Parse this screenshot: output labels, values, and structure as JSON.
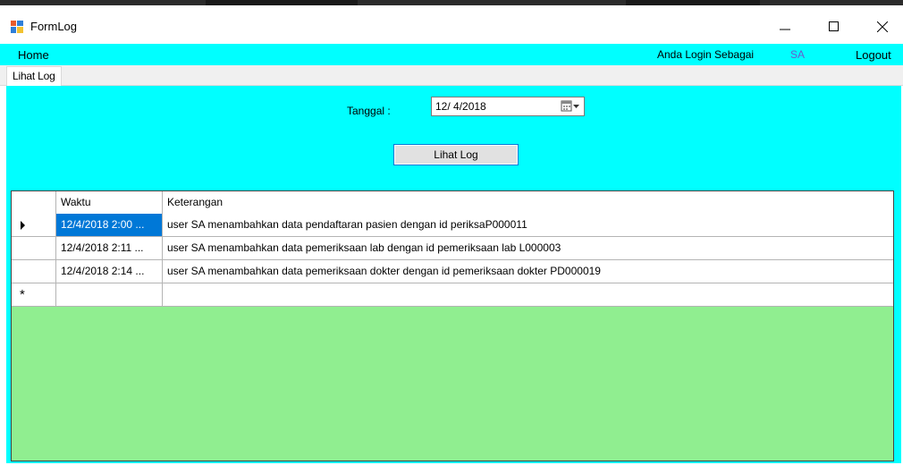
{
  "window": {
    "title": "FormLog",
    "icon": "form-app-icon",
    "controls": {
      "minimize": "minimize-icon",
      "maximize": "maximize-icon",
      "close": "close-icon"
    }
  },
  "menubar": {
    "home": "Home",
    "login_label": "Anda Login Sebagai",
    "login_user": "SA",
    "logout": "Logout"
  },
  "tabs": [
    {
      "label": "Lihat Log"
    }
  ],
  "form": {
    "tanggal_label": "Tanggal :",
    "tanggal_value": "12/ 4/2018",
    "lihat_log_button": "Lihat Log"
  },
  "grid": {
    "columns": [
      "Waktu",
      "Keterangan"
    ],
    "rows": [
      {
        "waktu": "12/4/2018 2:00 ...",
        "keterangan": "user  SA menambahkan data pendaftaran pasien dengan id periksaP000011",
        "selected": true
      },
      {
        "waktu": "12/4/2018 2:11 ...",
        "keterangan": "user  SA menambahkan data pemeriksaan lab dengan id pemeriksaan lab L000003",
        "selected": false
      },
      {
        "waktu": "12/4/2018 2:14 ...",
        "keterangan": "user  SA menambahkan data pemeriksaan dokter dengan id pemeriksaan dokter PD000019",
        "selected": false
      }
    ],
    "current_row_marker": "row-pointer-icon",
    "new_row_marker": "*"
  },
  "colors": {
    "menubar_bg": "#00ffff",
    "content_bg": "#00ffff",
    "grid_empty_bg": "#90ee90",
    "selection": "#0078d7",
    "login_user": "#6a5acd"
  }
}
